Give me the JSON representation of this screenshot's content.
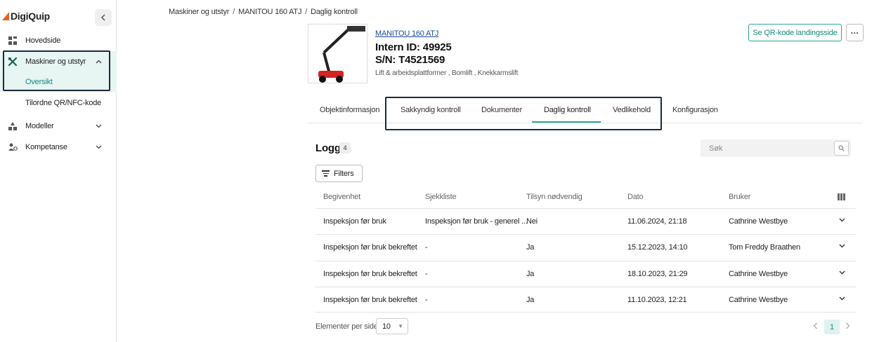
{
  "sidebar": {
    "logo": "DigiQuip",
    "collapse_icon": "chevron-left-icon",
    "items": [
      {
        "label": "Hovedside",
        "icon": "dashboard-icon"
      },
      {
        "label": "Maskiner og utstyr",
        "icon": "tools-icon",
        "expanded": true
      },
      {
        "label": "Oversikt",
        "sub": true,
        "active": true
      },
      {
        "label": "Tilordne QR/NFC-kode",
        "sub": true
      },
      {
        "label": "Modeller",
        "icon": "models-icon"
      },
      {
        "label": "Kompetanse",
        "icon": "people-icon"
      }
    ]
  },
  "breadcrumb": [
    "Maskiner og utstyr",
    "MANITOU 160 ATJ",
    "Daglig kontroll"
  ],
  "machine": {
    "model_link": "MANITOU 160 ATJ",
    "intern_id": "Intern ID: 49925",
    "serial": "S/N: T4521569",
    "category": "Lift & arbeidsplattformer , Bomlift , Knekkarmslift"
  },
  "header_actions": {
    "qr_button": "Se QR-kode landingsside",
    "more_button": "···"
  },
  "tabs": [
    {
      "label": "Objektinformasjon",
      "active": false
    },
    {
      "label": "Sakkyndig kontroll",
      "active": false
    },
    {
      "label": "Dokumenter",
      "active": false
    },
    {
      "label": "Daglig kontroll",
      "active": true
    },
    {
      "label": "Vedlikehold",
      "active": false
    },
    {
      "label": "Konfigurasjon",
      "active": false
    }
  ],
  "log": {
    "title": "Logg",
    "count": "4",
    "search_placeholder": "Søk",
    "filters_label": "Filters",
    "columns": [
      "Begivenhet",
      "Sjekkliste",
      "Tilsyn nødvendig",
      "Dato",
      "Bruker"
    ],
    "rows": [
      {
        "event": "Inspeksjon før bruk",
        "checklist": "Inspeksjon før bruk - generel ...",
        "needed": "Nei",
        "date": "11.06.2024, 21:18",
        "user": "Cathrine Westbye"
      },
      {
        "event": "Inspeksjon før bruk bekreftet",
        "checklist": "-",
        "needed": "Ja",
        "date": "15.12.2023, 14:10",
        "user": "Tom Freddy Braathen"
      },
      {
        "event": "Inspeksjon før bruk bekreftet",
        "checklist": "-",
        "needed": "Ja",
        "date": "18.10.2023, 21:29",
        "user": "Cathrine Westbye"
      },
      {
        "event": "Inspeksjon før bruk bekreftet",
        "checklist": "-",
        "needed": "Ja",
        "date": "11.10.2023, 12:21",
        "user": "Cathrine Westbye"
      }
    ]
  },
  "pagination": {
    "per_page_label": "Elementer per side",
    "per_page_value": "10",
    "current_page": "1"
  },
  "colors": {
    "accent": "#2aa698",
    "logo_orange": "#e8631c",
    "highlight_box": "#1b2b3a"
  }
}
